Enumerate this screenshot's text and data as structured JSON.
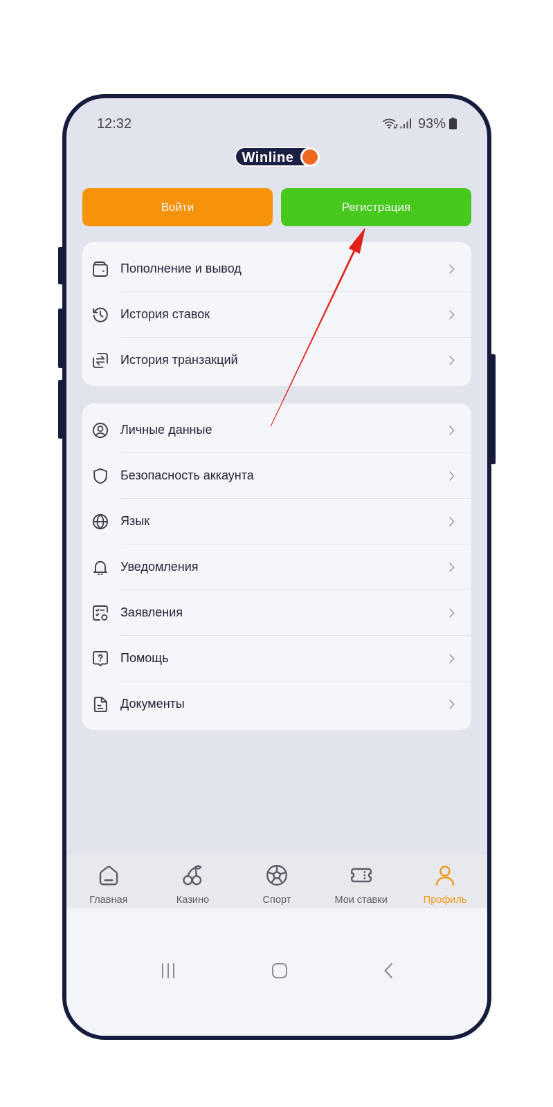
{
  "status_bar": {
    "time": "12:32",
    "battery_text": "93%"
  },
  "logo": {
    "text": "Winline"
  },
  "auth_buttons": [
    {
      "label": "Войти",
      "kind": "login"
    },
    {
      "label": "Регистрация",
      "kind": "register"
    }
  ],
  "menu_groups": [
    {
      "items": [
        {
          "label": "Пополнение и вывод"
        },
        {
          "label": "История ставок"
        },
        {
          "label": "История транзакций"
        }
      ]
    },
    {
      "items": [
        {
          "label": "Личные данные"
        },
        {
          "label": "Безопасность аккаунта"
        },
        {
          "label": "Язык"
        },
        {
          "label": "Уведомления"
        },
        {
          "label": "Заявления"
        },
        {
          "label": "Помощь"
        },
        {
          "label": "Документы"
        }
      ]
    }
  ],
  "bottom_nav": [
    {
      "label": "Главная",
      "selected": false
    },
    {
      "label": "Казино",
      "selected": false
    },
    {
      "label": "Спорт",
      "selected": false
    },
    {
      "label": "Мои ставки",
      "selected": false
    },
    {
      "label": "Профиль",
      "selected": true
    }
  ]
}
